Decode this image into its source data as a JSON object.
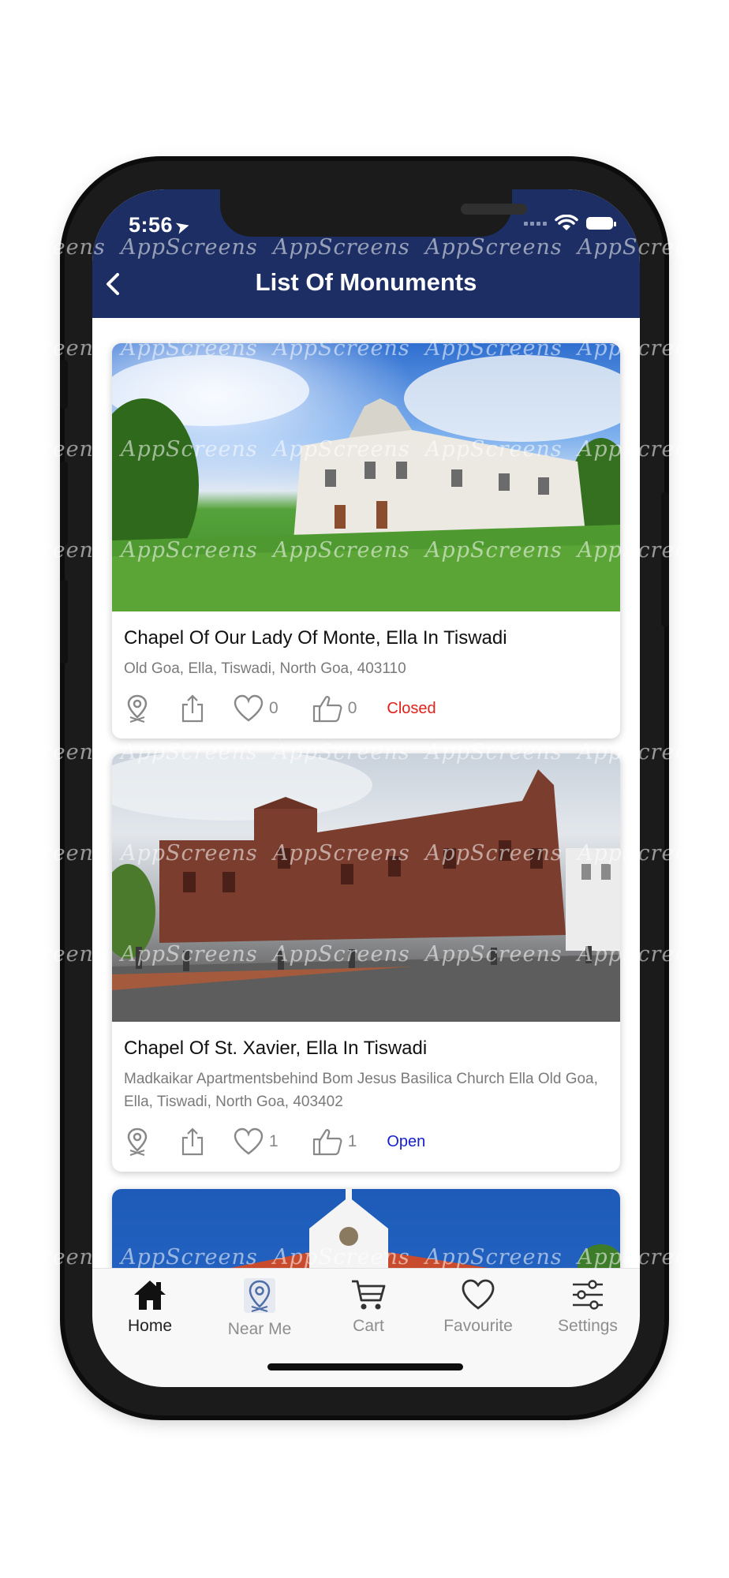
{
  "status_bar": {
    "time": "5:56"
  },
  "header": {
    "title": "List Of Monuments"
  },
  "monuments": [
    {
      "name": "Chapel Of Our Lady Of Monte, Ella In Tiswadi",
      "address": "Old Goa, Ella, Tiswadi, North Goa, 403110",
      "favourites": "0",
      "likes": "0",
      "status": "Closed",
      "status_color": "#e0201b"
    },
    {
      "name": "Chapel Of St. Xavier, Ella In Tiswadi",
      "address": "Madkaikar Apartmentsbehind Bom Jesus Basilica Church Ella Old Goa, Ella, Tiswadi, North Goa, 403402",
      "favourites": "1",
      "likes": "1",
      "status": "Open",
      "status_color": "#1720c8"
    }
  ],
  "tabbar": {
    "items": [
      {
        "label": "Home",
        "icon": "home-icon",
        "active": true
      },
      {
        "label": "Near Me",
        "icon": "map-pin-icon",
        "active": false
      },
      {
        "label": "Cart",
        "icon": "cart-icon",
        "active": false
      },
      {
        "label": "Favourite",
        "icon": "heart-icon",
        "active": false
      },
      {
        "label": "Settings",
        "icon": "sliders-icon",
        "active": false
      }
    ]
  },
  "watermark": "AppScreens",
  "colors": {
    "header_bg": "#1c2e63",
    "closed": "#e0201b",
    "open": "#1720c8"
  }
}
